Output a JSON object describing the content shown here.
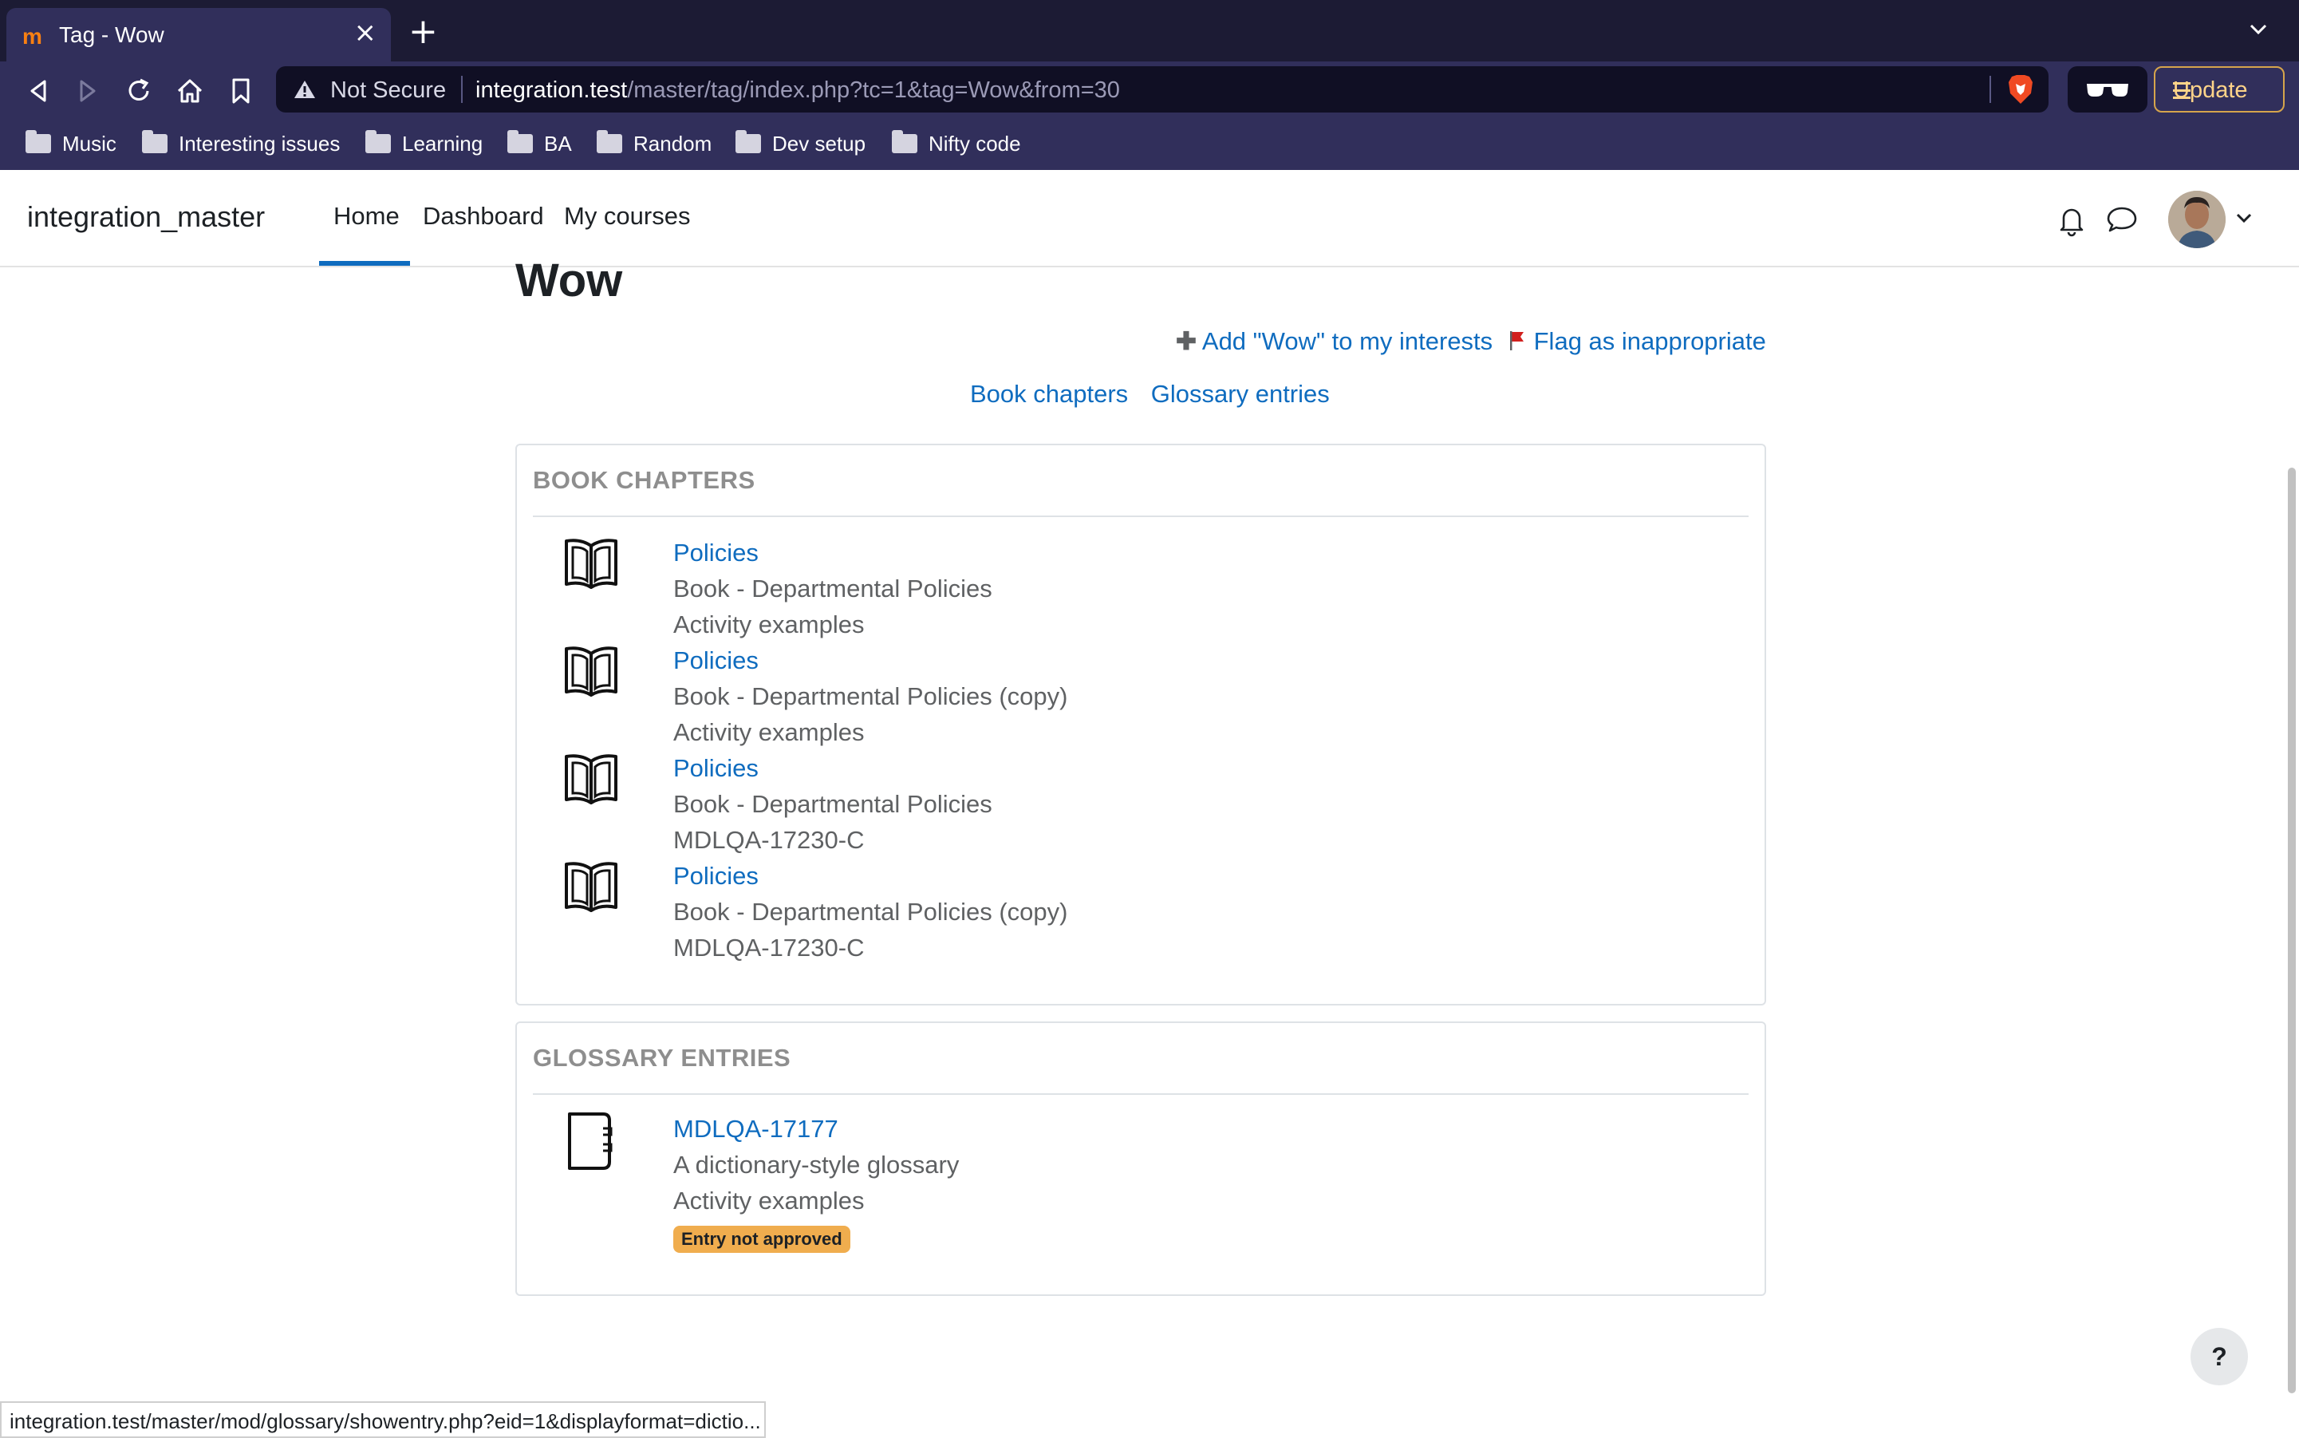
{
  "browser": {
    "tab_title": "Tag - Wow",
    "tab_favicon": "m",
    "close_glyph": "×",
    "newtab_glyph": "+",
    "security_label": "Not Secure",
    "url_host": "integration.test",
    "url_path": "/master/tag/index.php?tc=1&tag=Wow&from=30",
    "update_label": "Update",
    "bookmarks": [
      "Music",
      "Interesting issues",
      "Learning",
      "BA",
      "Random",
      "Dev setup",
      "Nifty code"
    ]
  },
  "site": {
    "name": "integration_master",
    "nav": [
      "Home",
      "Dashboard",
      "My courses"
    ]
  },
  "page": {
    "title": "Wow",
    "add_interest": "Add \"Wow\" to my interests",
    "flag": "Flag as inappropriate",
    "jump_links": [
      "Book chapters",
      "Glossary entries"
    ]
  },
  "book_section": {
    "heading": "BOOK CHAPTERS",
    "items": [
      {
        "title": "Policies",
        "context": "Book - Departmental Policies",
        "course": "Activity examples"
      },
      {
        "title": "Policies",
        "context": "Book - Departmental Policies (copy)",
        "course": "Activity examples"
      },
      {
        "title": "Policies",
        "context": "Book - Departmental Policies",
        "course": "MDLQA-17230-C"
      },
      {
        "title": "Policies",
        "context": "Book - Departmental Policies (copy)",
        "course": "MDLQA-17230-C"
      }
    ]
  },
  "glossary_section": {
    "heading": "GLOSSARY ENTRIES",
    "items": [
      {
        "title": "MDLQA-17177",
        "context": "A dictionary-style glossary",
        "course": "Activity examples",
        "badge": "Entry not approved"
      }
    ]
  },
  "status_url": "integration.test/master/mod/glossary/showentry.php?eid=1&displayformat=dictio...",
  "help_label": "?",
  "colors": {
    "link": "#0f6cbf",
    "badge": "#f0ad4e",
    "chrome": "#312f5b"
  }
}
